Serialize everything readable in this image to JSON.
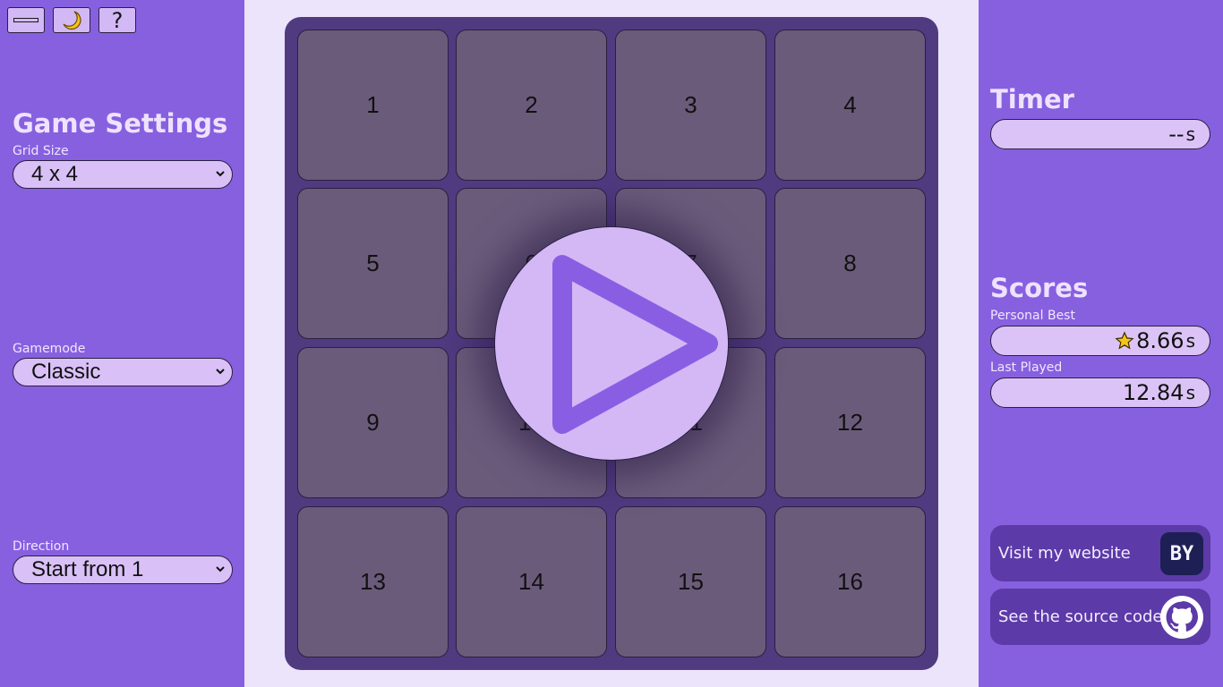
{
  "toolbar": {
    "minimize_icon": "minimize-icon",
    "theme_icon": "crescent-moon-icon",
    "help_label": "?"
  },
  "settings": {
    "title": "Game Settings",
    "grid_size_label": "Grid Size",
    "grid_size_value": "4 x 4",
    "gamemode_label": "Gamemode",
    "gamemode_value": "Classic",
    "direction_label": "Direction",
    "direction_value": "Start from 1"
  },
  "board": {
    "tiles": [
      "1",
      "2",
      "3",
      "4",
      "5",
      "6",
      "7",
      "8",
      "9",
      "10",
      "11",
      "12",
      "13",
      "14",
      "15",
      "16"
    ],
    "play_icon": "play-icon"
  },
  "timer": {
    "title": "Timer",
    "value": "--",
    "unit": "s"
  },
  "scores": {
    "title": "Scores",
    "personal_best_label": "Personal Best",
    "personal_best_value": "8.66",
    "personal_best_unit": "s",
    "last_played_label": "Last Played",
    "last_played_value": "12.84",
    "last_played_unit": "s"
  },
  "links": {
    "website_label": "Visit my website",
    "website_logo": "BY",
    "source_label": "See the source code"
  },
  "colors": {
    "side_panel": "#8760e0",
    "board": "#503a80",
    "tile": "#6b5b7b",
    "accent_light": "#d4b8f5",
    "play_triangle": "#8a5ee3"
  }
}
